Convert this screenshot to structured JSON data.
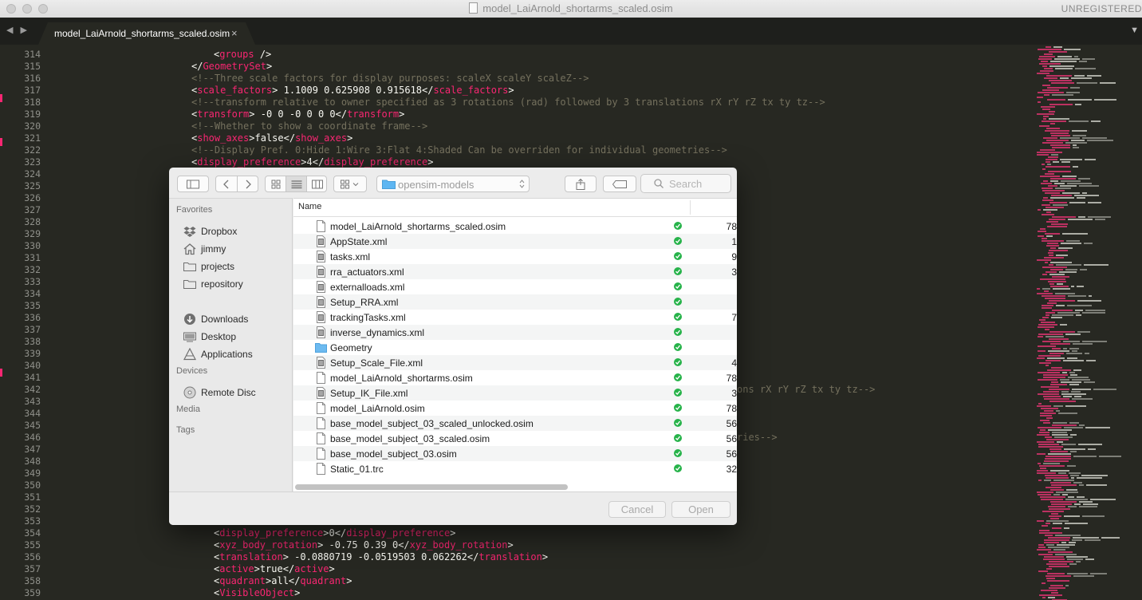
{
  "window": {
    "title": "model_LaiArnold_shortarms_scaled.osim",
    "badge": "UNREGISTERED"
  },
  "tabbar": {
    "nav": "◀ ▶",
    "tab_label": "model_LaiArnold_shortarms_scaled.osim",
    "close": "×",
    "menu": "▼"
  },
  "editor": {
    "line_numbers": [
      "314",
      "315",
      "316",
      "317",
      "318",
      "319",
      "320",
      "321",
      "322",
      "323",
      "324",
      "325",
      "326",
      "327",
      "328",
      "329",
      "330",
      "331",
      "332",
      "333",
      "334",
      "335",
      "336",
      "337",
      "338",
      "339",
      "340",
      "341",
      "342",
      "343",
      "344",
      "345",
      "346",
      "347",
      "348",
      "349",
      "350",
      "351",
      "352",
      "353",
      "354",
      "355",
      "356",
      "357",
      "358",
      "359"
    ],
    "lines": [
      {
        "indent": 4,
        "parts": [
          {
            "t": "<"
          },
          {
            "t": "groups",
            "k": "tag"
          },
          {
            "t": " />"
          }
        ]
      },
      {
        "indent": 3,
        "parts": [
          {
            "t": "</"
          },
          {
            "t": "GeometrySet",
            "k": "tag"
          },
          {
            "t": ">"
          }
        ]
      },
      {
        "indent": 3,
        "parts": [
          {
            "t": "<!--Three scale factors for display purposes: scaleX scaleY scaleZ-->",
            "k": "comment"
          }
        ]
      },
      {
        "indent": 3,
        "parts": [
          {
            "t": "<"
          },
          {
            "t": "scale_factors",
            "k": "tag"
          },
          {
            "t": "> 1.1009 0.625908 0.915618</"
          },
          {
            "t": "scale_factors",
            "k": "tag"
          },
          {
            "t": ">"
          }
        ]
      },
      {
        "indent": 3,
        "parts": [
          {
            "t": "<!--transform relative to owner specified as 3 rotations (rad) followed by 3 translations rX rY rZ tx ty tz-->",
            "k": "comment"
          }
        ]
      },
      {
        "indent": 3,
        "parts": [
          {
            "t": "<"
          },
          {
            "t": "transform",
            "k": "tag"
          },
          {
            "t": "> -0 0 -0 0 0 0</"
          },
          {
            "t": "transform",
            "k": "tag"
          },
          {
            "t": ">"
          }
        ]
      },
      {
        "indent": 3,
        "parts": [
          {
            "t": "<!--Whether to show a coordinate frame-->",
            "k": "comment"
          }
        ]
      },
      {
        "indent": 3,
        "parts": [
          {
            "t": "<"
          },
          {
            "t": "show_axes",
            "k": "tag"
          },
          {
            "t": ">false</"
          },
          {
            "t": "show_axes",
            "k": "tag"
          },
          {
            "t": ">"
          }
        ]
      },
      {
        "indent": 3,
        "parts": [
          {
            "t": "<!--Display Pref. 0:Hide 1:Wire 3:Flat 4:Shaded Can be overriden for individual geometries-->",
            "k": "comment"
          }
        ]
      },
      {
        "indent": 3,
        "parts": [
          {
            "t": "<"
          },
          {
            "t": "display_preference",
            "k": "tag"
          },
          {
            "t": ">4</"
          },
          {
            "t": "display_preference",
            "k": "tag"
          },
          {
            "t": ">"
          }
        ]
      }
    ],
    "peek_342": "ons rX rY rZ tx ty tz-->",
    "peek_346": "ries-->",
    "bottom_lines": [
      {
        "indent": 4,
        "parts": [
          {
            "t": "<"
          },
          {
            "t": "display_preference",
            "k": "tag"
          },
          {
            "t": ">0</"
          },
          {
            "t": "display_preference",
            "k": "tag"
          },
          {
            "t": ">"
          }
        ]
      },
      {
        "indent": 4,
        "parts": [
          {
            "t": "<"
          },
          {
            "t": "xyz_body_rotation",
            "k": "tag"
          },
          {
            "t": "> -0.75 0.39 0</"
          },
          {
            "t": "xyz_body_rotation",
            "k": "tag"
          },
          {
            "t": ">"
          }
        ]
      },
      {
        "indent": 4,
        "parts": [
          {
            "t": "<"
          },
          {
            "t": "translation",
            "k": "tag"
          },
          {
            "t": "> -0.0880719 -0.0519503 0.062262</"
          },
          {
            "t": "translation",
            "k": "tag"
          },
          {
            "t": ">"
          }
        ]
      },
      {
        "indent": 4,
        "parts": [
          {
            "t": "<"
          },
          {
            "t": "active",
            "k": "tag"
          },
          {
            "t": ">true</"
          },
          {
            "t": "active",
            "k": "tag"
          },
          {
            "t": ">"
          }
        ]
      },
      {
        "indent": 4,
        "parts": [
          {
            "t": "<"
          },
          {
            "t": "quadrant",
            "k": "tag"
          },
          {
            "t": ">all</"
          },
          {
            "t": "quadrant",
            "k": "tag"
          },
          {
            "t": ">"
          }
        ]
      },
      {
        "indent": 4,
        "parts": [
          {
            "t": "<"
          },
          {
            "t": "VisibleObject",
            "k": "tag"
          },
          {
            "t": ">"
          }
        ]
      }
    ]
  },
  "dialog": {
    "path_folder": "opensim-models",
    "search_placeholder": "Search",
    "sidebar": {
      "favorites_header": "Favorites",
      "favorites": [
        {
          "label": "Dropbox",
          "icon": "dropbox-icon"
        },
        {
          "label": "jimmy",
          "icon": "home-icon"
        },
        {
          "label": "projects",
          "icon": "folder-icon"
        },
        {
          "label": "repository",
          "icon": "folder-icon"
        },
        {
          "label": "Downloads",
          "icon": "downloads-icon"
        },
        {
          "label": "Desktop",
          "icon": "desktop-icon"
        },
        {
          "label": "Applications",
          "icon": "applications-icon"
        }
      ],
      "devices_header": "Devices",
      "devices": [
        {
          "label": "Remote Disc",
          "icon": "disc-icon"
        }
      ],
      "media_header": "Media",
      "tags_header": "Tags"
    },
    "column_name": "Name",
    "files": [
      {
        "name": "model_LaiArnold_shortarms_scaled.osim",
        "size": "78",
        "icon": "file-icon"
      },
      {
        "name": "AppState.xml",
        "size": "1",
        "icon": "xml-file-icon"
      },
      {
        "name": "tasks.xml",
        "size": "9",
        "icon": "xml-file-icon"
      },
      {
        "name": "rra_actuators.xml",
        "size": "3",
        "icon": "xml-file-icon"
      },
      {
        "name": "externalloads.xml",
        "size": "",
        "icon": "xml-file-icon"
      },
      {
        "name": "Setup_RRA.xml",
        "size": "",
        "icon": "xml-file-icon"
      },
      {
        "name": "trackingTasks.xml",
        "size": "7",
        "icon": "xml-file-icon"
      },
      {
        "name": "inverse_dynamics.xml",
        "size": "",
        "icon": "xml-file-icon"
      },
      {
        "name": "Geometry",
        "size": "",
        "icon": "folder-icon"
      },
      {
        "name": "Setup_Scale_File.xml",
        "size": "4",
        "icon": "xml-file-icon"
      },
      {
        "name": "model_LaiArnold_shortarms.osim",
        "size": "78",
        "icon": "file-icon"
      },
      {
        "name": "Setup_IK_File.xml",
        "size": "3",
        "icon": "xml-file-icon"
      },
      {
        "name": "model_LaiArnold.osim",
        "size": "78",
        "icon": "file-icon"
      },
      {
        "name": "base_model_subject_03_scaled_unlocked.osim",
        "size": "56",
        "icon": "file-icon"
      },
      {
        "name": "base_model_subject_03_scaled.osim",
        "size": "56",
        "icon": "file-icon"
      },
      {
        "name": "base_model_subject_03.osim",
        "size": "56",
        "icon": "file-icon"
      },
      {
        "name": "Static_01.trc",
        "size": "32",
        "icon": "file-icon"
      }
    ],
    "cancel_label": "Cancel",
    "open_label": "Open"
  }
}
